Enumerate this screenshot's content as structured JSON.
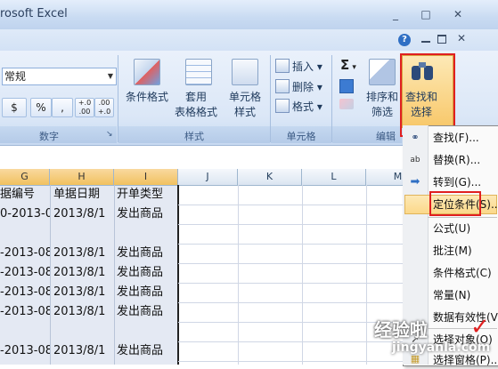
{
  "window": {
    "title": "rosoft Excel",
    "minimize": "_",
    "maximize": "□",
    "close": "✕"
  },
  "ribbon": {
    "help_symbol": "?",
    "number_group": {
      "format_value": "常规",
      "currency_symbol": "$",
      "percent_symbol": "%",
      "comma_symbol": ",",
      "inc_decimal": "+.0 .00",
      "dec_decimal": ".00 +.0",
      "label": "数字"
    },
    "styles_group": {
      "conditional_format": "条件格式",
      "table_format_line1": "套用",
      "table_format_line2": "表格格式",
      "cell_style_line1": "单元格",
      "cell_style_line2": "样式",
      "label": "样式"
    },
    "cells_group": {
      "insert": "插入",
      "delete": "删除",
      "format": "格式",
      "label": "单元格"
    },
    "edit_group": {
      "sum_symbol": "Σ",
      "sort_filter_line1": "排序和",
      "sort_filter_line2": "筛选",
      "find_select_line1": "查找和",
      "find_select_line2": "选择",
      "label": "编辑"
    }
  },
  "grid": {
    "columns": [
      "G",
      "H",
      "I",
      "J",
      "K",
      "L",
      "M"
    ],
    "rows": [
      [
        "据编号",
        "单据日期",
        "开单类型"
      ],
      [
        "0-2013-0",
        "2013/8/1",
        "发出商品"
      ],
      [
        "",
        "",
        ""
      ],
      [
        "-2013-08",
        "2013/8/1",
        "发出商品"
      ],
      [
        "-2013-08",
        "2013/8/1",
        "发出商品"
      ],
      [
        "-2013-08",
        "2013/8/1",
        "发出商品"
      ],
      [
        "-2013-08",
        "2013/8/1",
        "发出商品"
      ],
      [
        "",
        "",
        ""
      ],
      [
        "-2013-08",
        "2013/8/1",
        "发出商品"
      ]
    ]
  },
  "menu": {
    "items": [
      "查找(F)...",
      "替换(R)...",
      "转到(G)...",
      "定位条件(S)...",
      "公式(U)",
      "批注(M)",
      "条件格式(C)",
      "常量(N)",
      "数据有效性(V)",
      "选择对象(O)",
      "选择窗格(P)..."
    ]
  },
  "watermark": {
    "text": "经验啦",
    "check": "✓",
    "url": "jingyanla.com"
  },
  "colors": {
    "highlight_red": "#e02020",
    "ribbon_blue": "#dbe7f7"
  }
}
